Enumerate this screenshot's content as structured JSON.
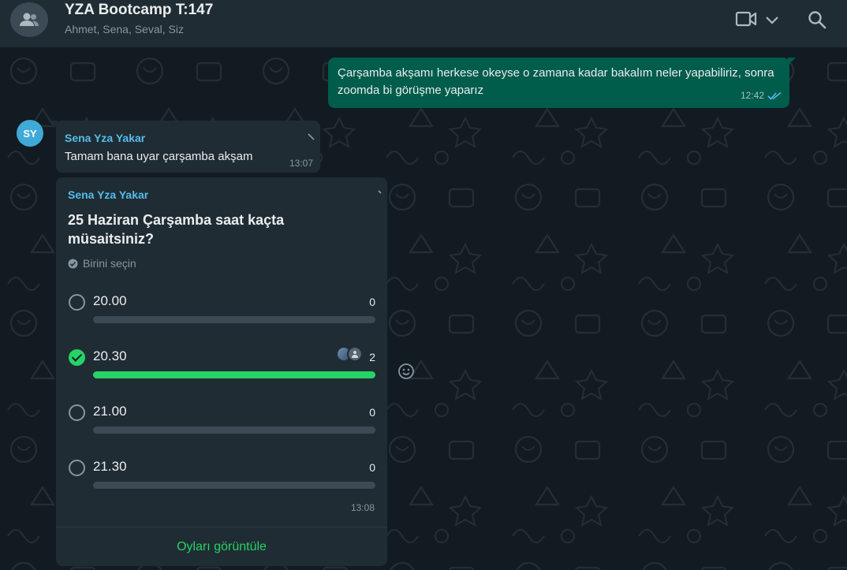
{
  "header": {
    "title": "YZA Bootcamp T:147",
    "subtitle": "Ahmet, Sena, Seval, Siz",
    "avatar_icon": "group-icon",
    "video_icon": "video-call-icon",
    "dropdown_icon": "chevron-down-icon",
    "search_icon": "search-icon"
  },
  "messages": {
    "outgoing": {
      "text": "Çarşamba akşamı herkese okeyse o zamana kadar bakalım neler yapabiliriz, sonra zoomda bi görüşme yaparız",
      "time": "12:42",
      "status_icon": "double-check-icon"
    },
    "incoming": {
      "avatar": "SY",
      "sender": "Sena Yza Yakar",
      "text": "Tamam bana uyar çarşamba akşam",
      "time": "13:07"
    }
  },
  "poll": {
    "sender": "Sena Yza Yakar",
    "question": "25 Haziran Çarşamba saat kaçta müsaitsiniz?",
    "hint": "Birini seçin",
    "options": [
      {
        "label": "20.00",
        "count": "0",
        "checked": false,
        "fraction": 0
      },
      {
        "label": "20.30",
        "count": "2",
        "checked": true,
        "fraction": 1
      },
      {
        "label": "21.00",
        "count": "0",
        "checked": false,
        "fraction": 0
      },
      {
        "label": "21.30",
        "count": "0",
        "checked": false,
        "fraction": 0
      }
    ],
    "time": "13:08",
    "view_votes_label": "Oyları görüntüle"
  },
  "colors": {
    "accent": "#25d366",
    "outgoing_bubble": "#005c4b",
    "incoming_bubble": "#202c33",
    "sender_name": "#53bdeb"
  }
}
